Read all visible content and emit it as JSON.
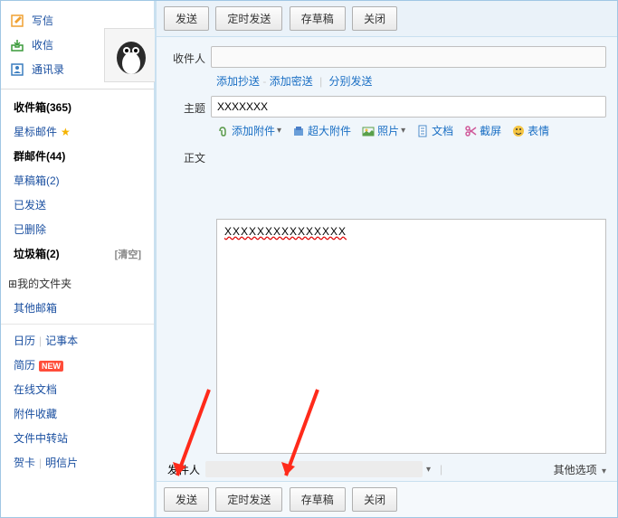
{
  "sidebar": {
    "compose": "写信",
    "receive": "收信",
    "contacts": "通讯录",
    "folders": [
      {
        "label": "收件箱(365)",
        "bold": true
      },
      {
        "label": "星标邮件",
        "star": true
      },
      {
        "label": "群邮件(44)",
        "bold": true
      },
      {
        "label": "草稿箱(2)"
      },
      {
        "label": "已发送"
      },
      {
        "label": "已删除"
      },
      {
        "label": "垃圾箱(2)",
        "bold": true,
        "clear": "[清空]"
      }
    ],
    "myFolders": "我的文件夹",
    "otherMailbox": "其他邮箱",
    "calendar": "日历",
    "notes": "记事本",
    "resume": "简历",
    "newLabel": "NEW",
    "onlineDocs": "在线文档",
    "attachments": "附件收藏",
    "fileStation": "文件中转站",
    "cards": "贺卡",
    "postcards": "明信片"
  },
  "toolbar": {
    "send": "发送",
    "timedSend": "定时发送",
    "saveDraft": "存草稿",
    "close": "关闭"
  },
  "compose": {
    "toLabel": "收件人",
    "addCc": "添加抄送",
    "addBcc": "添加密送",
    "sendSeparate": "分别发送",
    "subjectLabel": "主题",
    "subjectValue": "XXXXXXX",
    "addAttachment": "添加附件",
    "bigAttachment": "超大附件",
    "photo": "照片",
    "docs": "文档",
    "screenshot": "截屏",
    "emoji": "表情",
    "bodyLabel": "正文",
    "bodyValue": "XXXXXXXXXXXXXXX",
    "senderLabel": "发件人",
    "otherOptions": "其他选项"
  }
}
